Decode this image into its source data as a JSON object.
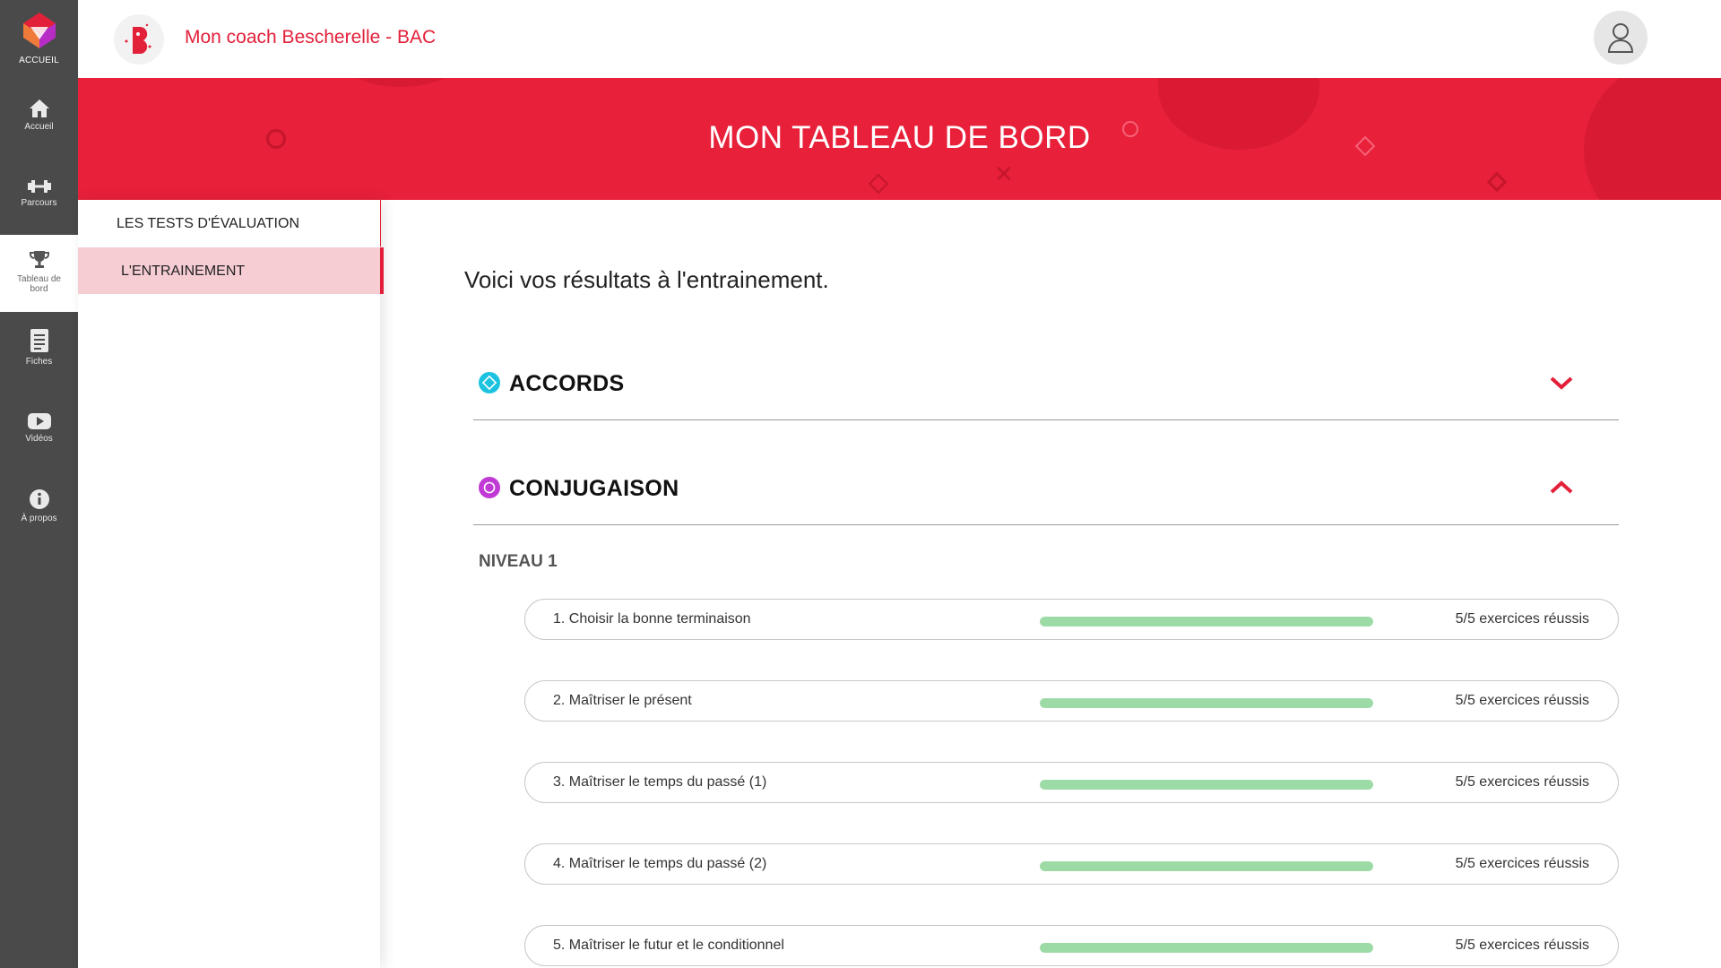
{
  "rail": {
    "logo_label": "ACCUEIL",
    "items": [
      {
        "label": "Accueil",
        "icon": "home-icon"
      },
      {
        "label": "Parcours",
        "icon": "dumbbell-icon"
      },
      {
        "label": "Tableau de bord",
        "icon": "trophy-icon"
      },
      {
        "label": "Fiches",
        "icon": "document-icon"
      },
      {
        "label": "Vidéos",
        "icon": "play-icon"
      },
      {
        "label": "À propos",
        "icon": "info-icon"
      }
    ],
    "active_index": 2
  },
  "header": {
    "title": "Mon coach Bescherelle - BAC",
    "accent_color": "#e3203a"
  },
  "banner": {
    "title": "MON TABLEAU DE BORD",
    "color": "#e8203a"
  },
  "menu": {
    "items": [
      {
        "label": "LES TESTS D'ÉVALUATION",
        "active": false
      },
      {
        "label": "L'ENTRAINEMENT",
        "active": true
      }
    ]
  },
  "main": {
    "intro": "Voici vos résultats à l'entrainement.",
    "categories": [
      {
        "name": "ACCORDS",
        "color": "#1cc3e0",
        "expanded": false
      },
      {
        "name": "CONJUGAISON",
        "color": "#c23ad6",
        "expanded": true
      }
    ],
    "level": "NIVEAU 1",
    "exercises": [
      {
        "title": "1. Choisir la bonne terminaison",
        "progress": 1.0,
        "score": "5/5 exercices réussis"
      },
      {
        "title": "2. Maîtriser le présent",
        "progress": 1.0,
        "score": "5/5 exercices réussis"
      },
      {
        "title": "3. Maîtriser le temps du passé (1)",
        "progress": 1.0,
        "score": "5/5 exercices réussis"
      },
      {
        "title": "4. Maîtriser le temps du passé (2)",
        "progress": 1.0,
        "score": "5/5 exercices réussis"
      },
      {
        "title": "5. Maîtriser le futur et le conditionnel",
        "progress": 1.0,
        "score": "5/5 exercices réussis"
      }
    ]
  }
}
